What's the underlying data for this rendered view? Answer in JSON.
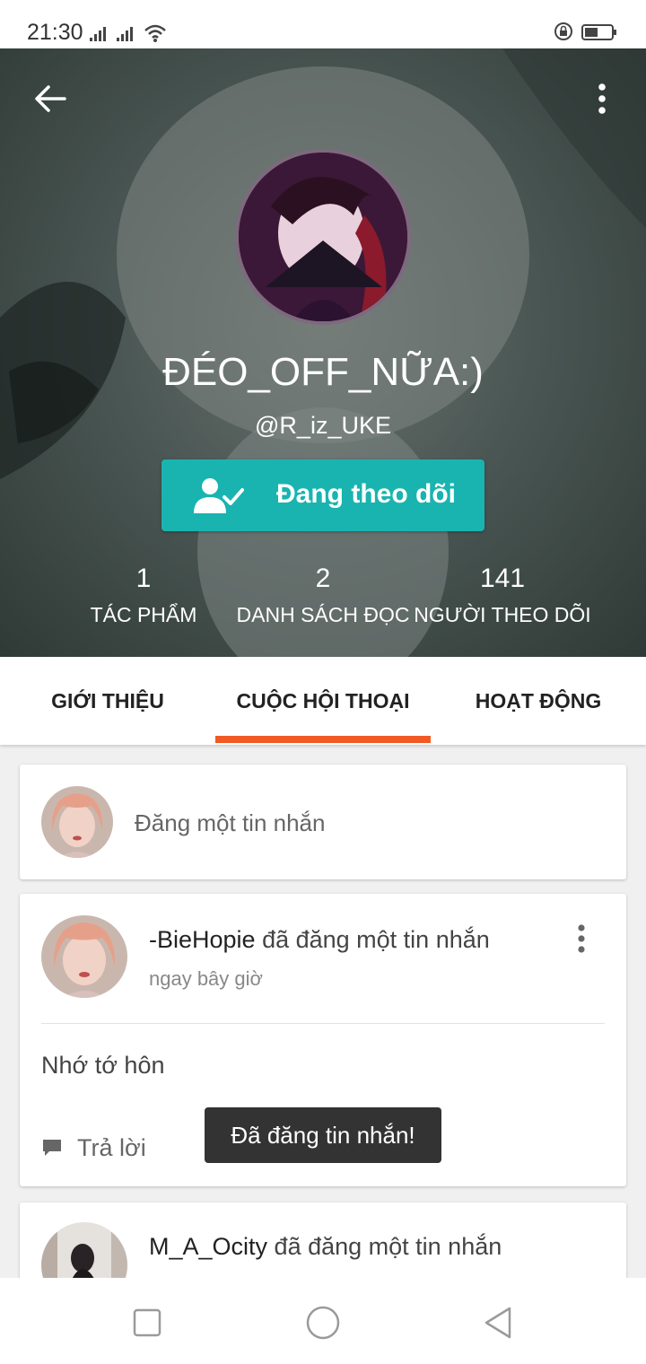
{
  "status_bar": {
    "time": "21:30"
  },
  "profile": {
    "display_name": "ĐÉO_OFF_NỮA:)",
    "username": "@R_iz_UKE",
    "follow_button_label": "Đang theo dõi",
    "stats": [
      {
        "value": "1",
        "label": "TÁC PHẨM"
      },
      {
        "value": "2",
        "label": "DANH SÁCH ĐỌC"
      },
      {
        "value": "141",
        "label": "NGƯỜI THEO DÕI"
      }
    ]
  },
  "tabs": [
    {
      "label": "GIỚI THIỆU"
    },
    {
      "label": "CUỘC HỘI THOẠI"
    },
    {
      "label": "HOẠT ĐỘNG"
    }
  ],
  "active_tab": "CUỘC HỘI THOẠI",
  "compose": {
    "placeholder": "Đăng một tin nhắn"
  },
  "posts": [
    {
      "author": "-BieHopie",
      "action": " đã đăng một tin nhắn",
      "time": "ngay bây giờ",
      "body": "Nhớ tớ hôn",
      "reply_label": "Trả lời"
    },
    {
      "author": "M_A_Ocity",
      "action": " đã đăng một tin nhắn"
    }
  ],
  "toast": "Đã đăng tin nhắn!",
  "colors": {
    "accent_teal": "#19b4b0",
    "tab_indicator": "#f15a24",
    "toast_bg": "#333333"
  },
  "icons": [
    "back-arrow-icon",
    "more-vertical-icon",
    "user-check-icon",
    "comment-icon",
    "nav-square-icon",
    "nav-circle-icon",
    "nav-triangle-icon"
  ]
}
